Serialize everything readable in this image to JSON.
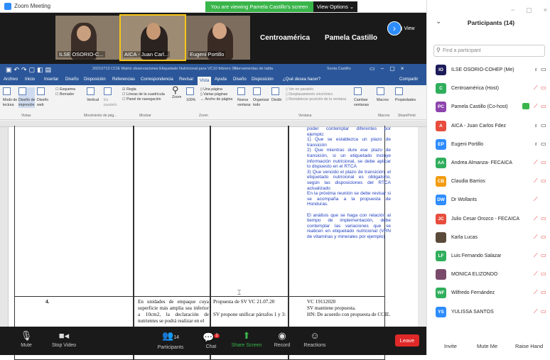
{
  "window": {
    "title": "Zoom Meeting"
  },
  "banner": {
    "text": "You are viewing Pamela Castillo's screen",
    "view_options": "View Options ⌄"
  },
  "video": {
    "tiles": [
      "ILSE OSORIO-C...",
      "AICA - Juan Carl...",
      "Eugeni Portillo"
    ],
    "name_tiles": [
      "Centroamérica",
      "Pamela Castillo"
    ],
    "view_label": "View"
  },
  "word": {
    "filename": "20210713 CCIE Matriz observaciones Etiquetado Nutricional  para VC10 febrero 20...",
    "table_tools": "Herramientas de tabla",
    "user": "Sonia Castillo",
    "tabs": [
      "Archivo",
      "Inicio",
      "Insertar",
      "Diseño",
      "Disposición",
      "Referencias",
      "Correspondencia",
      "Revisar",
      "Vista",
      "Ayuda",
      "Diseño",
      "Disposición",
      "¿Qué desea hacer?",
      "Compartir"
    ],
    "active_tab": "Vista",
    "ribbon": {
      "b1": "Modo de",
      "b1b": "lectura",
      "b2": "Diseño de",
      "b2b": "impresión",
      "b3": "Diseño",
      "b3b": "web",
      "esquema": "Esquema",
      "borrador": "Borrador",
      "vertical": "Vertical",
      "enparalelo": "En",
      "enparalelo2": "paralelo",
      "regla": "Regla",
      "lineas": "Líneas de la cuadrícula",
      "panel": "Panel de navegación",
      "zoom": "Zoom",
      "zoom100": "100%",
      "unapagina": "Una página",
      "varias": "Varias páginas",
      "ancho": "Ancho de página",
      "nueva": "Nueva",
      "nueva2": "ventana",
      "organizar": "Organizar",
      "organizar2": "todo",
      "dividir": "Dividir",
      "verparalelo": "Ver en paralelo",
      "despl": "Desplazamiento sincrónico",
      "restablecer": "Restablecer posición de la ventana",
      "cambiar": "Cambiar",
      "cambiar2": "ventanas",
      "macros": "Macros",
      "propiedades": "Propiedades",
      "groups": [
        "Vistas",
        "Movimiento de pág...",
        "Mostrar",
        "Zoom",
        "Ventana",
        "Macros",
        "SharePoint"
      ]
    },
    "blue_text": "poder contemplar diferentes por ejemplo:\n1) Que se establezca un plazo de transición\n2) Que mientras dure ese plazo de transición, si un etiquetado incluye información nutricional, se debe aplicar lo dispuesto en el RTCA\n3) Que vencido el plazo de transición, el etiquetado nutricional es obligatorio, según las disposiciones del RTCA actualizado\nEn la próxima reunión se debe revisar si se acompaña a la propuesta de Honduras.\n\nEl análisis que se haga con relación al tiempo de implementación, debe contemplar las variaciones que se realicen en etiquetado nutricional (VRN de vitaminas y minerales por ejemplo)",
    "row_num": "4.",
    "cell_a": "En unidades de empaque cuya superficie más amplia sea inferior a 10cm2, la declaración de nutrientes se podrá realizar en el",
    "cell_b1": "Propuesta de SV VC 21.07.20",
    "cell_b2": "SV propone unificar párrafos 1 y 3:",
    "cell_c": "VC 19112020\nSV mantiene propuesta.\nHN: De acuerdo con propuesta de CCIE."
  },
  "toolbar": {
    "mute": "Mute",
    "stop_video": "Stop Video",
    "participants": "Participants",
    "participants_count": "14",
    "chat": "Chat",
    "chat_badge": "2",
    "share": "Share Screen",
    "record": "Record",
    "reactions": "Reactions",
    "end": "Leave"
  },
  "panel": {
    "title": "Participants (14)",
    "search_placeholder": "Find a participant",
    "participants": [
      {
        "initials": "IO",
        "name": "ILSE OSORIO-COHEP (Me)",
        "color": "#1c1c5a"
      },
      {
        "initials": "C",
        "name": "Centroamérica (Host)",
        "color": "#2fae5c"
      },
      {
        "initials": "PC",
        "name": "Pamela Castillo (Co-host)",
        "color": "#8e44ad"
      },
      {
        "initials": "A",
        "name": "AICA - Juan Carlos Fdez",
        "color": "#e74c3c"
      },
      {
        "initials": "EP",
        "name": "Eugeni Portillo",
        "color": "#2d8cff"
      },
      {
        "initials": "AA",
        "name": "Andrea Almanza- FECAICA",
        "color": "#2fae5c"
      },
      {
        "initials": "CB",
        "name": "Claudia Barrios",
        "color": "#f39c12"
      },
      {
        "initials": "DW",
        "name": "Dr Wollants",
        "color": "#2d8cff"
      },
      {
        "initials": "JC",
        "name": "Julio Cesar Orozco - FECAICA",
        "color": "#e74c3c"
      },
      {
        "initials": "",
        "name": "Karla Lucas",
        "color": "#5a4a3a"
      },
      {
        "initials": "LF",
        "name": "Luis Fernando Salazar",
        "color": "#2fae5c"
      },
      {
        "initials": "",
        "name": "MONICA ELIZONDO",
        "color": "#7a4a6a"
      },
      {
        "initials": "WF",
        "name": "Wilfredo Fernández",
        "color": "#2fae5c"
      },
      {
        "initials": "YS",
        "name": "YULISSA SANTOS",
        "color": "#2d8cff"
      }
    ],
    "invite": "Invite",
    "mute_me": "Mute Me",
    "raise_hand": "Raise Hand"
  }
}
